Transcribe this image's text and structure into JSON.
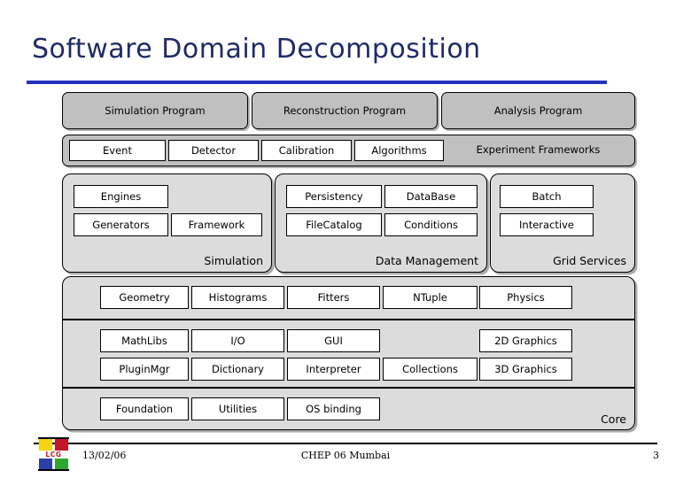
{
  "slide": {
    "title": "Software Domain Decomposition",
    "accent_color": "#2233BB",
    "title_color": "#1F2A66",
    "band_gray": "#C0C0C0",
    "panel_gray": "#DCDCDC"
  },
  "programs": [
    {
      "label": "Simulation Program"
    },
    {
      "label": "Reconstruction Program"
    },
    {
      "label": "Analysis Program"
    }
  ],
  "frameworks": {
    "boxes": [
      {
        "label": "Event"
      },
      {
        "label": "Detector"
      },
      {
        "label": "Calibration"
      },
      {
        "label": "Algorithms"
      }
    ],
    "row_label": "Experiment Frameworks"
  },
  "domains": [
    {
      "label": "Simulation",
      "cells": [
        {
          "label": "Engines"
        },
        {
          "label": "Generators"
        },
        {
          "label": "Framework"
        }
      ]
    },
    {
      "label": "Data Management",
      "cells": [
        {
          "label": "Persistency"
        },
        {
          "label": "DataBase"
        },
        {
          "label": "FileCatalog"
        },
        {
          "label": "Conditions"
        }
      ]
    },
    {
      "label": "Grid Services",
      "cells": [
        {
          "label": "Batch"
        },
        {
          "label": "Interactive"
        }
      ]
    }
  ],
  "core": {
    "label": "Core",
    "band1": [
      {
        "label": "Geometry"
      },
      {
        "label": "Histograms"
      },
      {
        "label": "Fitters"
      },
      {
        "label": "NTuple"
      },
      {
        "label": "Physics"
      }
    ],
    "band2_row1": [
      {
        "label": "MathLibs"
      },
      {
        "label": "I/O"
      },
      {
        "label": "GUI"
      },
      {
        "label": "2D Graphics"
      }
    ],
    "band2_row2": [
      {
        "label": "PluginMgr"
      },
      {
        "label": "Dictionary"
      },
      {
        "label": "Interpreter"
      },
      {
        "label": "Collections"
      },
      {
        "label": "3D Graphics"
      }
    ],
    "band3": [
      {
        "label": "Foundation"
      },
      {
        "label": "Utilities"
      },
      {
        "label": "OS binding"
      }
    ]
  },
  "footer": {
    "date": "13/02/06",
    "center": "CHEP 06 Mumbai",
    "page": "3",
    "logo_text": "LCG"
  }
}
